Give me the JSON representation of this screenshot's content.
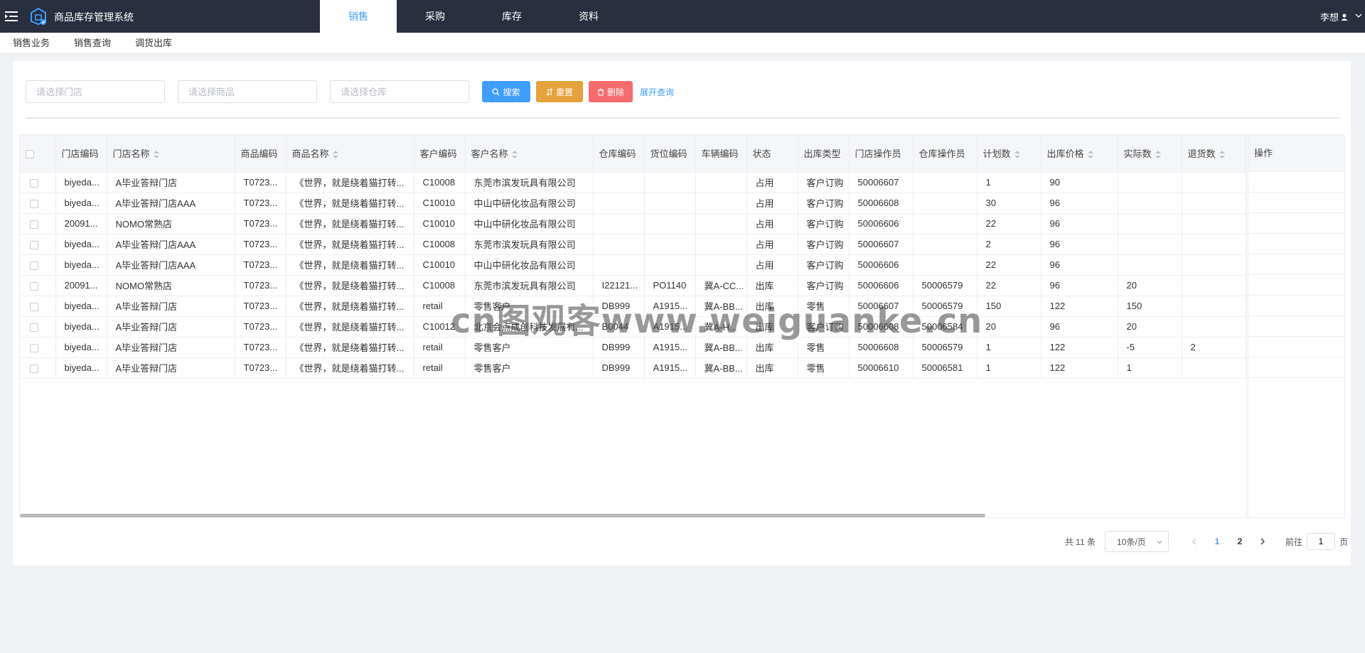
{
  "app": {
    "title": "商品库存管理系统",
    "brand_color": "#409eff",
    "topbar_color": "#2a2f3e"
  },
  "nav": {
    "items": [
      "销售",
      "采购",
      "库存",
      "资料"
    ],
    "active": "销售"
  },
  "user": {
    "name": "李想"
  },
  "subnav": {
    "items": [
      "销售业务",
      "销售查询",
      "调货出库"
    ]
  },
  "filters": {
    "store_placeholder": "请选择门店",
    "goods_placeholder": "请选择商品",
    "warehouse_placeholder": "请选择仓库",
    "search_label": "搜索",
    "reset_label": "重置",
    "delete_label": "删除",
    "expand_label": "展开查询"
  },
  "table": {
    "columns": [
      "门店编码",
      "门店名称",
      "商品编码",
      "商品名称",
      "客户编码",
      "客户名称",
      "仓库编码",
      "货位编码",
      "车辆编码",
      "状态",
      "出库类型",
      "门店操作员",
      "仓库操作员",
      "计划数",
      "出库价格",
      "实际数",
      "退货数"
    ],
    "ops_header": "操作",
    "rows": [
      [
        "biyeda...",
        "A毕业答辩门店",
        "T0723...",
        "《世界，就是绕着猫打转...",
        "C10008",
        "东莞市滨发玩具有限公司",
        "",
        "",
        "",
        "占用",
        "客户订购",
        "50006607",
        "",
        "1",
        "90",
        "",
        ""
      ],
      [
        "biyeda...",
        "A毕业答辩门店AAA",
        "T0723...",
        "《世界，就是绕着猫打转...",
        "C10010",
        "中山中研化妆品有限公司",
        "",
        "",
        "",
        "占用",
        "客户订购",
        "50006608",
        "",
        "30",
        "96",
        "",
        ""
      ],
      [
        "20091...",
        "NOMO常熟店",
        "T0723...",
        "《世界，就是绕着猫打转...",
        "C10010",
        "中山中研化妆品有限公司",
        "",
        "",
        "",
        "占用",
        "客户订购",
        "50006606",
        "",
        "22",
        "96",
        "",
        ""
      ],
      [
        "biyeda...",
        "A毕业答辩门店AAA",
        "T0723...",
        "《世界，就是绕着猫打转...",
        "C10008",
        "东莞市滨发玩具有限公司",
        "",
        "",
        "",
        "占用",
        "客户订购",
        "50006607",
        "",
        "2",
        "96",
        "",
        ""
      ],
      [
        "biyeda...",
        "A毕业答辩门店AAA",
        "T0723...",
        "《世界，就是绕着猫打转...",
        "C10010",
        "中山中研化妆品有限公司",
        "",
        "",
        "",
        "占用",
        "客户订购",
        "50006606",
        "",
        "22",
        "96",
        "",
        ""
      ],
      [
        "20091...",
        "NOMO常熟店",
        "T0723...",
        "《世界，就是绕着猫打转...",
        "C10008",
        "东莞市滨发玩具有限公司",
        "I22121...",
        "PO1140",
        "冀A-CC...",
        "出库",
        "客户订购",
        "50006606",
        "50006579",
        "22",
        "96",
        "20",
        ""
      ],
      [
        "biyeda...",
        "A毕业答辩门店",
        "T0723...",
        "《世界，就是绕着猫打转...",
        "retail",
        "零售客户",
        "DB999",
        "A1915...",
        "冀A-BB...",
        "出库",
        "零售",
        "50006607",
        "50006579",
        "150",
        "122",
        "150",
        ""
      ],
      [
        "biyeda...",
        "A毕业答辩门店",
        "T0723...",
        "《世界，就是绕着猫打转...",
        "C10012",
        "北京会点成创科技发展有...",
        "B0044",
        "A1915...",
        "冀A-H...",
        "出库",
        "客户订购",
        "50006608",
        "50006584",
        "20",
        "96",
        "20",
        ""
      ],
      [
        "biyeda...",
        "A毕业答辩门店",
        "T0723...",
        "《世界，就是绕着猫打转...",
        "retail",
        "零售客户",
        "DB999",
        "A1915...",
        "冀A-BB...",
        "出库",
        "零售",
        "50006608",
        "50006579",
        "1",
        "122",
        "-5",
        "2"
      ],
      [
        "biyeda...",
        "A毕业答辩门店",
        "T0723...",
        "《世界，就是绕着猫打转...",
        "retail",
        "零售客户",
        "DB999",
        "A1915...",
        "冀A-BB...",
        "出库",
        "零售",
        "50006610",
        "50006581",
        "1",
        "122",
        "1",
        ""
      ]
    ]
  },
  "pagination": {
    "total": "共 11 条",
    "page_size": "10条/页",
    "pages": [
      "1",
      "2"
    ],
    "current": "1",
    "goto_prefix": "前往",
    "goto_value": "1",
    "goto_suffix": "页"
  },
  "watermark": "cn图观客www.weiguanke.cn"
}
